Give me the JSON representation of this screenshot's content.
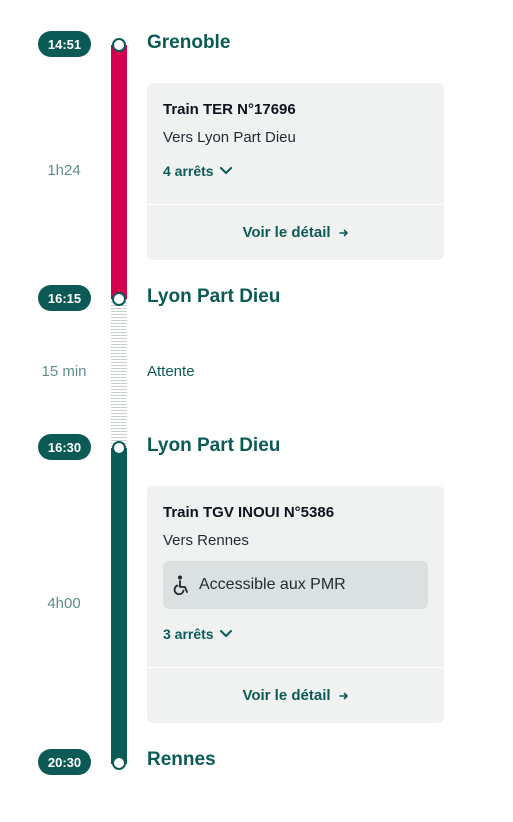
{
  "segments": [
    {
      "departure_time": "14:51",
      "departure_station": "Grenoble",
      "duration": "1h24",
      "train": "Train TER N°17696",
      "direction": "Vers Lyon Part Dieu",
      "stops": "4 arrêts",
      "detail_link": "Voir le détail",
      "line_color": "#d4004d"
    },
    {
      "departure_time": "16:30",
      "departure_station": "Lyon Part Dieu",
      "duration": "4h00",
      "train": "Train TGV INOUI N°5386",
      "direction": "Vers Rennes",
      "accessibility": "Accessible aux PMR",
      "stops": "3 arrêts",
      "detail_link": "Voir le détail",
      "line_color": "#0c5a55"
    }
  ],
  "connection": {
    "arrival_time": "16:15",
    "station": "Lyon Part Dieu",
    "duration": "15 min",
    "label": "Attente"
  },
  "arrival": {
    "time": "20:30",
    "station": "Rennes"
  },
  "colors": {
    "accent": "#0c5a55",
    "ter": "#d4004d",
    "card_bg": "#f0f2f2"
  }
}
